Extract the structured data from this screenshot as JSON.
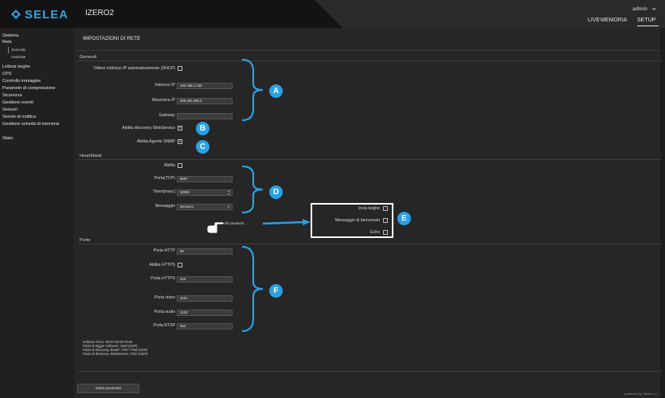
{
  "header": {
    "logo_text": "SELEA",
    "device_name": "IZERO2",
    "nav": [
      "LIVE",
      "MEMORIA",
      "SETUP"
    ],
    "user": "admin",
    "accent": "#2fa4e7"
  },
  "sidebar": {
    "items": [
      "Sistema",
      "Rete",
      "Lettura targhe",
      "CPS",
      "Controllo immagine",
      "Parametri di compressione",
      "Sicurezza",
      "Gestione eventi",
      "Sensori",
      "Servizi di notifica",
      "Gestione scheda di memoria",
      "Stato"
    ],
    "sub_items": [
      "Generale",
      "Avanzate"
    ]
  },
  "page": {
    "title": "IMPOSTAZIONI DI RETE"
  },
  "generali": {
    "section": "Generali",
    "dhcp_label": "Ottieni indirizzo IP automaticamente (DHCP)",
    "ip_label": "Indirizzo IP",
    "ip_value": "192.168.1.135",
    "mask_label": "Maschera IP",
    "mask_value": "255.255.255.0",
    "gateway_label": "Gateway",
    "gateway_value": "",
    "discovery_label": "Abilita discovery WebService",
    "snmp_label": "Abilita Agente SNMP"
  },
  "heartbeat": {
    "section": "Hearthbeat",
    "enable_label": "Abilita",
    "port_label": "Porta(TCP)",
    "port_value": "9667",
    "timer_label": "Timer[msec]",
    "timer_value": "30000",
    "msg_label": "Messaggio",
    "msg_value": "Nessuno",
    "more_link": "Altri parametri..."
  },
  "popup": {
    "send_plates": "Invia targhe",
    "welcome": "Messaggio di benvenuto",
    "echo": "Echo"
  },
  "porte": {
    "section": "Porte",
    "http_label": "Porta HTTP",
    "http_value": "80",
    "https_enable_label": "Abilita HTTPS",
    "https_label": "Porta HTTPS",
    "https_value": "443",
    "video_label": "Porta video",
    "video_value": "2101",
    "audio_label": "Porta audio",
    "audio_value": "2103",
    "rtsp_label": "Porta RTSP",
    "rtsp_value": "554"
  },
  "info": {
    "mac": "Indirizzo fisico: 00:07:60:00:76:e5",
    "trigger": "Porta di trigger software: 1168 (UDP)",
    "bootp": "Porta di discovery BootP: 7767-7768 (UDP)",
    "websvc": "Porta di discovery WebService: 3702 (UDP)"
  },
  "footer": {
    "save_label": "Salva parametri",
    "powered": "powered by Selea s.r.l."
  },
  "markers": [
    "A",
    "B",
    "C",
    "D",
    "E",
    "F"
  ]
}
